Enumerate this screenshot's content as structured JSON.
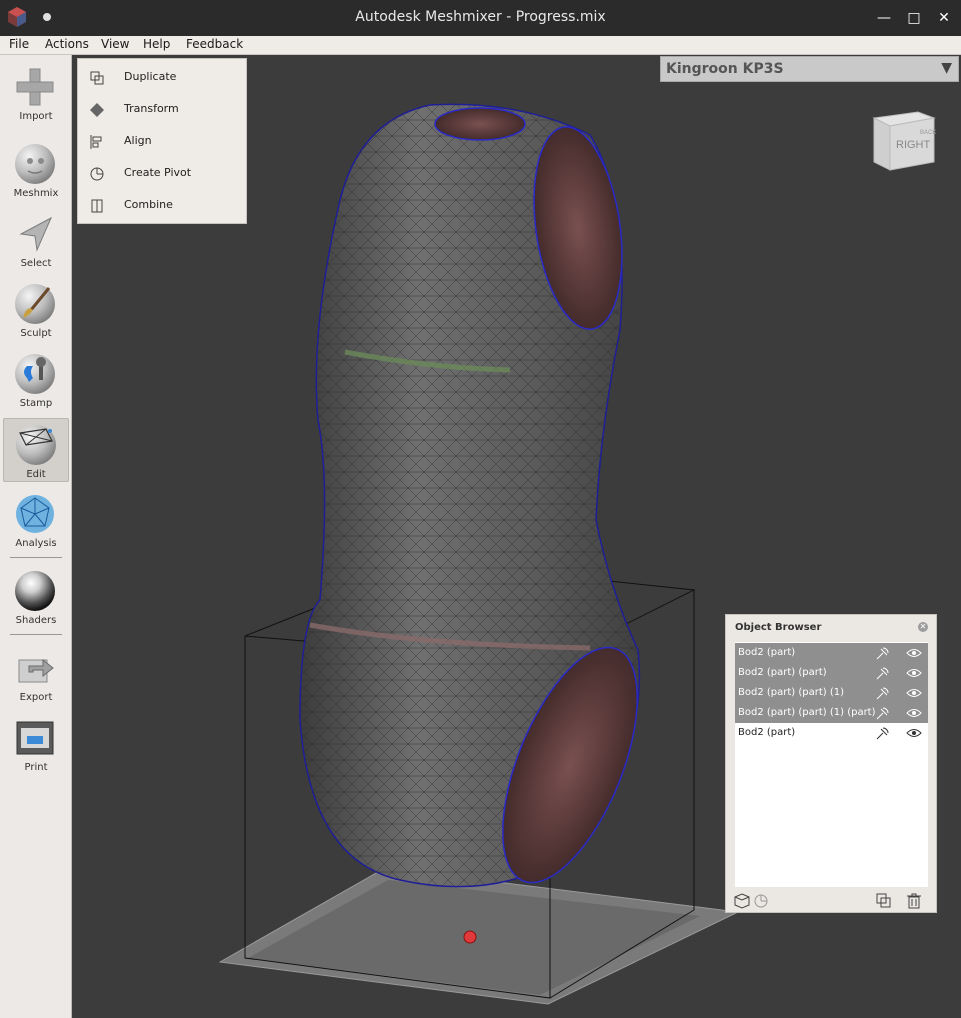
{
  "window": {
    "title": "Autodesk Meshmixer - Progress.mix"
  },
  "menu": {
    "items": [
      "File",
      "Actions",
      "View",
      "Help",
      "Feedback"
    ]
  },
  "toolbar": {
    "tools": [
      {
        "label": "Import",
        "icon": "plus-icon"
      },
      {
        "label": "Meshmix",
        "icon": "meshmix-head-icon"
      },
      {
        "label": "Select",
        "icon": "select-arrow-icon"
      },
      {
        "label": "Sculpt",
        "icon": "sculpt-brush-icon"
      },
      {
        "label": "Stamp",
        "icon": "stamp-icon"
      },
      {
        "label": "Edit",
        "icon": "edit-icon",
        "active": true
      },
      {
        "label": "Analysis",
        "icon": "analysis-icon"
      },
      {
        "label": "Shaders",
        "icon": "shaders-icon"
      },
      {
        "label": "Export",
        "icon": "export-icon"
      },
      {
        "label": "Print",
        "icon": "print-icon"
      }
    ]
  },
  "edit_menu": {
    "items": [
      {
        "label": "Duplicate",
        "icon": "duplicate-icon"
      },
      {
        "label": "Transform",
        "icon": "transform-icon"
      },
      {
        "label": "Align",
        "icon": "align-icon"
      },
      {
        "label": "Create Pivot",
        "icon": "pivot-icon"
      },
      {
        "label": "Combine",
        "icon": "combine-icon"
      }
    ]
  },
  "printer": {
    "name": "Kingroon KP3S"
  },
  "viewcube": {
    "face_label": "RIGHT",
    "side_label": "BACK"
  },
  "object_browser": {
    "title": "Object Browser",
    "objects": [
      {
        "name": "Bod2 (part)",
        "selected": true
      },
      {
        "name": "Bod2 (part) (part)",
        "selected": true
      },
      {
        "name": "Bod2 (part) (part) (1)",
        "selected": true
      },
      {
        "name": "Bod2 (part) (part) (1) (part)",
        "selected": true
      },
      {
        "name": "Bod2 (part)",
        "selected": false
      }
    ]
  },
  "colors": {
    "viewport_bg": "#3c3c3c",
    "selection_outline": "#2a2ac8",
    "panel_bg": "#ece9e6"
  }
}
